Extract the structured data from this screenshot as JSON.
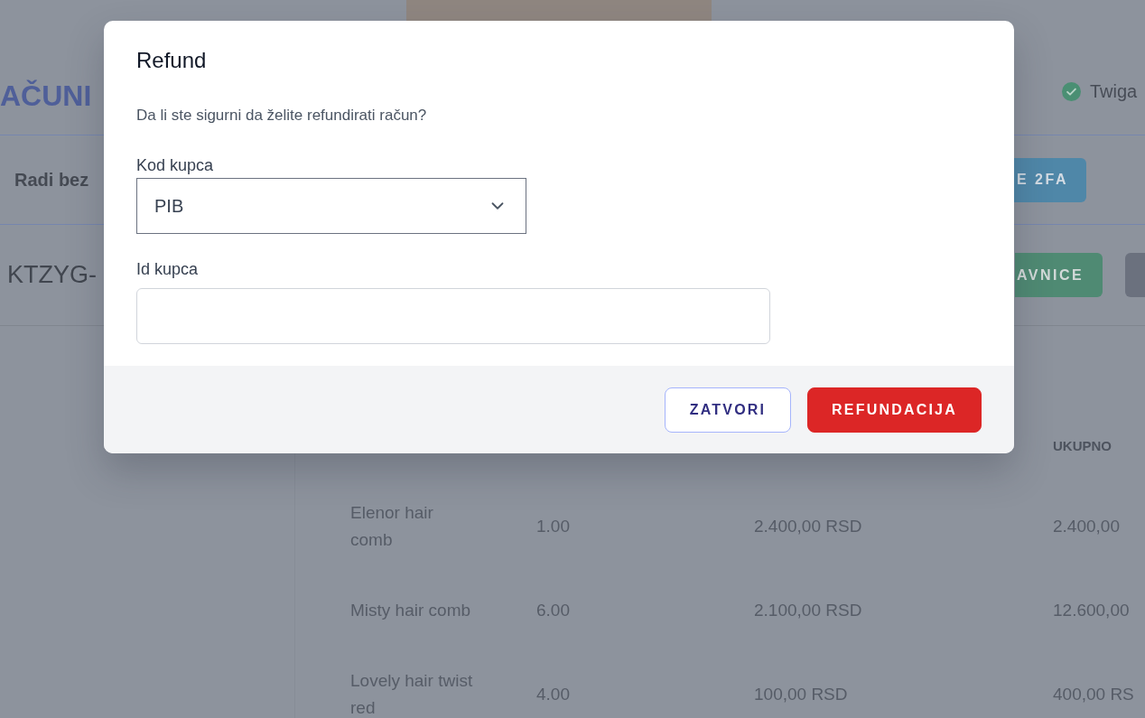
{
  "page": {
    "heading": "AČUNI",
    "user": {
      "name": "Twiga",
      "verified": true
    },
    "notice": {
      "text": "Radi bez",
      "button": "E 2FA"
    },
    "invoice": {
      "number": "KTZYG-",
      "buttons": [
        {
          "kind": "success",
          "label": "AVNICE"
        },
        {
          "kind": "neutral"
        }
      ]
    },
    "table": {
      "column_4_header": "UKUPNO",
      "rows": [
        {
          "cells": [
            "Elenor hair comb",
            "1.00",
            "2.400,00 RSD",
            "2.400,00"
          ]
        },
        {
          "cells": [
            "Misty hair comb",
            "6.00",
            "2.100,00 RSD",
            "12.600,00"
          ]
        },
        {
          "cells": [
            "Lovely hair twist red",
            "4.00",
            "100,00 RSD",
            "400,00 RS"
          ]
        }
      ]
    }
  },
  "modal": {
    "title": "Refund",
    "message": "Da li ste sigurni da želite refundirati račun?",
    "fields": [
      {
        "kind": "select",
        "label": "Kod kupca",
        "value": "PIB"
      },
      {
        "kind": "text",
        "label": "Id kupca"
      }
    ],
    "buttons": [
      {
        "kind": "secondary",
        "label": "ZATVORI"
      },
      {
        "kind": "danger",
        "label": "REFUNDACIJA"
      }
    ]
  }
}
